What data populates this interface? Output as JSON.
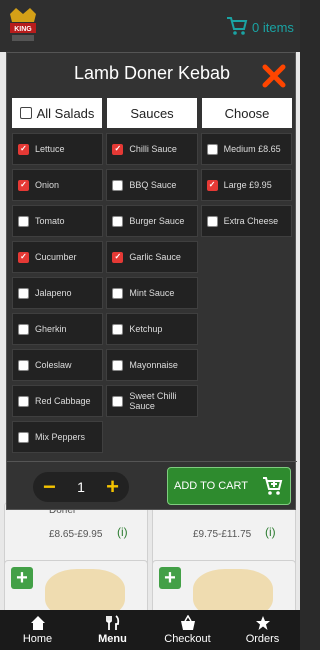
{
  "header": {
    "cart_count": "0 items"
  },
  "background": {
    "cards": [
      {
        "title": "Doner",
        "price": "£8.65-£9.95",
        "info": "(i)"
      },
      {
        "title": "",
        "price": "£9.75-£11.75",
        "info": "(i)"
      }
    ]
  },
  "modal": {
    "title": "Lamb Doner Kebab",
    "tabs": [
      "All Salads",
      "Sauces",
      "Choose"
    ],
    "salads": [
      {
        "label": "Lettuce",
        "checked": true
      },
      {
        "label": "Onion",
        "checked": true
      },
      {
        "label": "Tomato",
        "checked": false
      },
      {
        "label": "Cucumber",
        "checked": true
      },
      {
        "label": "Jalapeno",
        "checked": false
      },
      {
        "label": "Gherkin",
        "checked": false
      },
      {
        "label": "Coleslaw",
        "checked": false
      },
      {
        "label": "Red Cabbage",
        "checked": false
      },
      {
        "label": "Mix Peppers",
        "checked": false
      }
    ],
    "sauces": [
      {
        "label": "Chilli Sauce",
        "checked": true
      },
      {
        "label": "BBQ Sauce",
        "checked": false
      },
      {
        "label": "Burger Sauce",
        "checked": false
      },
      {
        "label": "Garlic Sauce",
        "checked": true
      },
      {
        "label": "Mint Sauce",
        "checked": false
      },
      {
        "label": "Ketchup",
        "checked": false
      },
      {
        "label": "Mayonnaise",
        "checked": false
      },
      {
        "label": "Sweet Chilli Sauce",
        "checked": false
      }
    ],
    "choose": [
      {
        "label": "Medium £8.65",
        "checked": false
      },
      {
        "label": "Large £9.95",
        "checked": true
      },
      {
        "label": "Extra Cheese",
        "checked": false
      }
    ],
    "quantity": "1",
    "add_to_cart_label": "ADD TO CART"
  },
  "nav": {
    "home": "Home",
    "menu": "Menu",
    "checkout": "Checkout",
    "orders": "Orders"
  },
  "colors": {
    "accent_red": "#e53935",
    "add_cart_green": "#2e8b2e",
    "qty_yellow": "#f5c400"
  }
}
